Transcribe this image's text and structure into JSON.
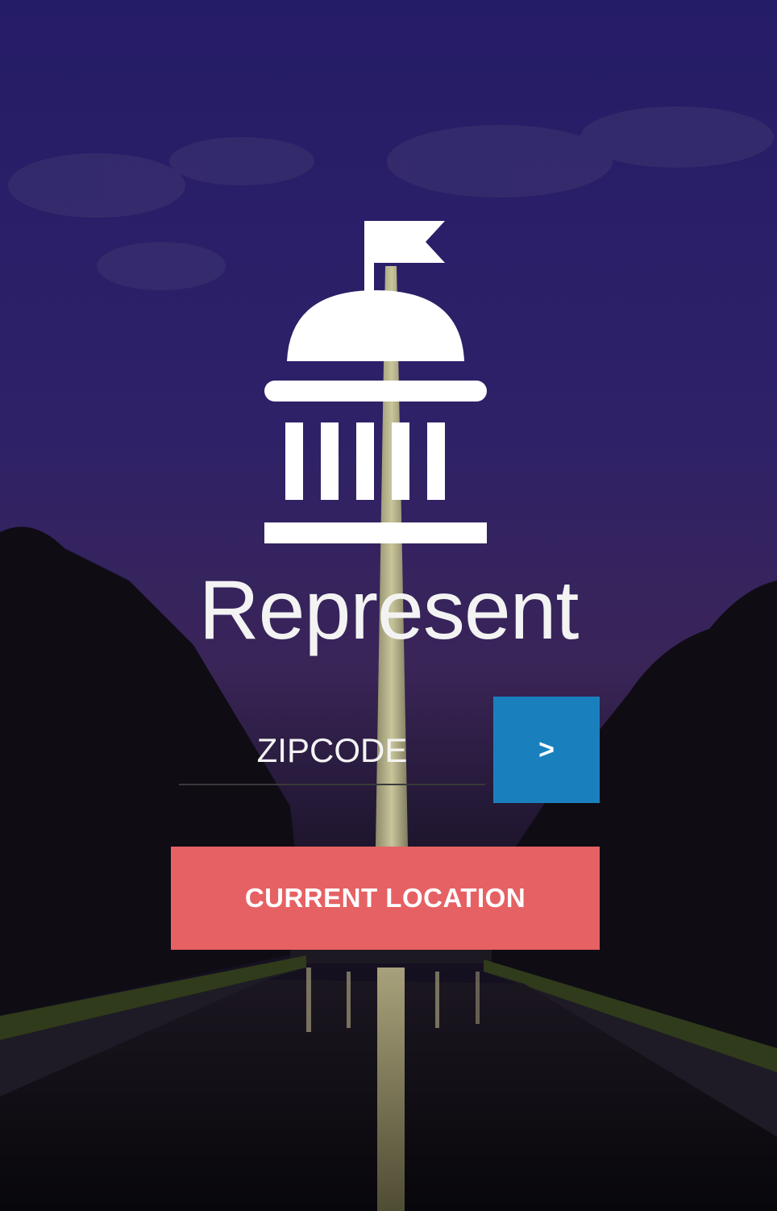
{
  "app": {
    "title": "Represent",
    "logo_icon": "capitol-building-icon"
  },
  "zipcode": {
    "placeholder": "ZIPCODE",
    "value": ""
  },
  "go_button": {
    "label": ">"
  },
  "location_button": {
    "label": "CURRENT LOCATION"
  },
  "colors": {
    "go_button": "#1a80bd",
    "location_button": "#e66163",
    "sky_top": "#2a1f6b",
    "sky_bottom": "#3a2556"
  },
  "background_icon": "washington-monument-photo"
}
